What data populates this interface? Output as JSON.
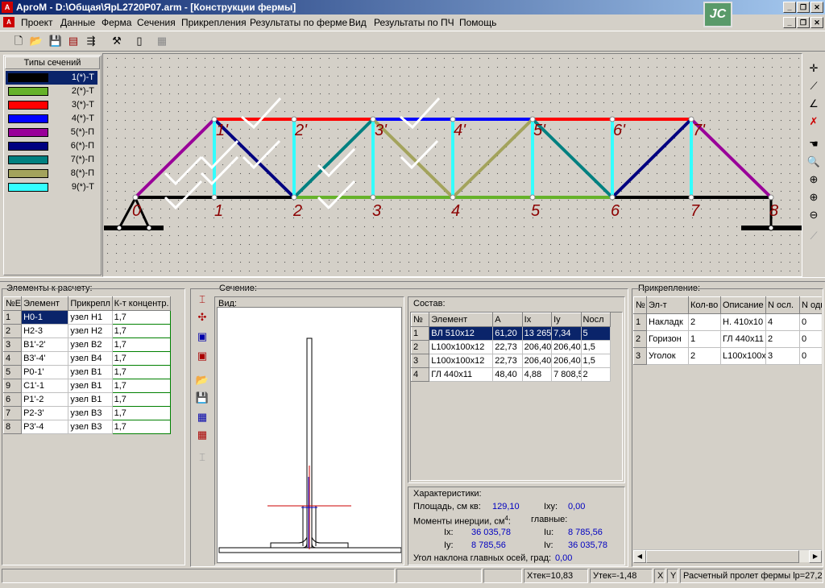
{
  "window": {
    "title": "АргоМ - D:\\Общая\\ЯрL2720P07.arm - [Конструкции фермы]",
    "app_icon": "ferma-logo-icon",
    "badge_text": "JC"
  },
  "menu": [
    "Проект",
    "Данные",
    "Ферма",
    "Сечения",
    "Прикрепления",
    "Результаты по ферме",
    "Вид",
    "Результаты по ПЧ",
    "Помощь"
  ],
  "section_types": {
    "title": "Типы сечений",
    "items": [
      {
        "label": "1(*)-Т",
        "color": "#000000"
      },
      {
        "label": "2(*)-Т",
        "color": "#66b22a"
      },
      {
        "label": "3(*)-Т",
        "color": "#ff0000"
      },
      {
        "label": "4(*)-Т",
        "color": "#0000ff"
      },
      {
        "label": "5(*)-П",
        "color": "#990099"
      },
      {
        "label": "6(*)-П",
        "color": "#000080"
      },
      {
        "label": "7(*)-П",
        "color": "#008080"
      },
      {
        "label": "8(*)-П",
        "color": "#a3a35c"
      },
      {
        "label": "9(*)-Т",
        "color": "#33ffff"
      }
    ]
  },
  "truss": {
    "bottom_nodes": [
      "0",
      "1",
      "2",
      "3",
      "4",
      "5",
      "6",
      "7",
      "8"
    ],
    "top_nodes": [
      "1'",
      "2'",
      "3'",
      "4'",
      "5'",
      "6'",
      "7'"
    ]
  },
  "elements_panel": {
    "title": "Элементы к расчету:",
    "columns": [
      "№Е",
      "Элемент",
      "Прикрепл",
      "К-т концентр."
    ],
    "rows": [
      [
        "1",
        "Н0-1",
        "узел Н1",
        "1,7"
      ],
      [
        "2",
        "Н2-3",
        "узел Н2",
        "1,7"
      ],
      [
        "3",
        "В1'-2'",
        "узел В2",
        "1,7"
      ],
      [
        "4",
        "В3'-4'",
        "узел В4",
        "1,7"
      ],
      [
        "5",
        "Р0-1'",
        "узел В1",
        "1,7"
      ],
      [
        "9",
        "С1'-1",
        "узел В1",
        "1,7"
      ],
      [
        "6",
        "Р1'-2",
        "узел В1",
        "1,7"
      ],
      [
        "7",
        "Р2-3'",
        "узел В3",
        "1,7"
      ],
      [
        "8",
        "Р3'-4",
        "узел В3",
        "1,7"
      ]
    ]
  },
  "section_panel": {
    "title": "Сечение:",
    "view_label": "Вид:",
    "composition": {
      "title": "Состав:",
      "columns": [
        "№",
        "Элемент",
        "А",
        "Ix",
        "Iy",
        "Nосл"
      ],
      "rows": [
        [
          "1",
          "ВЛ 510х12",
          "61,20",
          "13 265",
          "7,34",
          "5"
        ],
        [
          "2",
          "L100x100x12",
          "22,73",
          "206,40",
          "206,40",
          "1,5"
        ],
        [
          "3",
          "L100x100x12",
          "22,73",
          "206,40",
          "206,40",
          "1,5"
        ],
        [
          "4",
          "ГЛ 440х11",
          "48,40",
          "4,88",
          "7 808,5",
          "2"
        ]
      ]
    },
    "characteristics": {
      "title": "Характеристики:",
      "area_label": "Площадь, см кв:",
      "area_value": "129,10",
      "ixy_label": "Ixy:",
      "ixy_value": "0,00",
      "inertia_label": "Моменты инерции, см",
      "inertia_exp": "4",
      "inertia_suffix": ":",
      "main_label": "главные:",
      "ix_label": "Ix:",
      "ix_value": "36 035,78",
      "iu_label": "Iu:",
      "iu_value": "8 785,56",
      "iy_label": "Iy:",
      "iy_value": "8 785,56",
      "iv_label": "Iv:",
      "iv_value": "36 035,78",
      "angle_label": "Угол наклона главных осей, град:",
      "angle_value": "0,00"
    }
  },
  "attachment_panel": {
    "title": "Прикрепление:",
    "columns": [
      "№",
      "Эл-т",
      "Кол-во",
      "Описание",
      "N осл.",
      "N одн"
    ],
    "rows": [
      [
        "1",
        "Накладк",
        "2",
        "Н. 410х10",
        "4",
        "0"
      ],
      [
        "2",
        "Горизон",
        "1",
        "ГЛ 440х11",
        "2",
        "0"
      ],
      [
        "3",
        "Уголок",
        "2",
        "L100x100x",
        "3",
        "0"
      ]
    ]
  },
  "status": {
    "xtek": "Хтек=10,83",
    "ytek": "Утек=-1,48",
    "x": "X",
    "y": "Y",
    "span": "Расчетный пролет фермы lp=27,2м"
  }
}
